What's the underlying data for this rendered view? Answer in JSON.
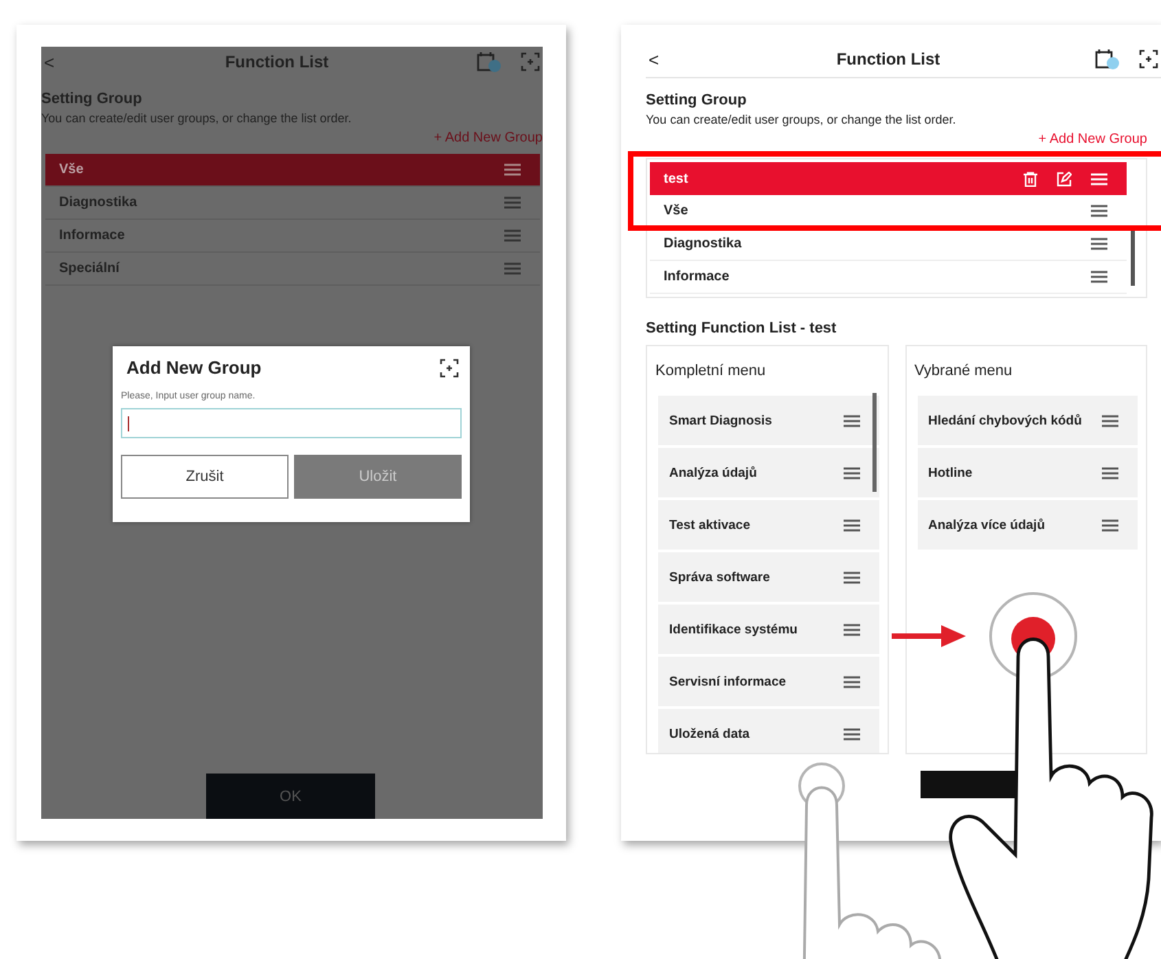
{
  "left_screen": {
    "header": {
      "back": "<",
      "title": "Function List"
    },
    "section_title": "Setting Group",
    "description": "You can create/edit user groups, or change the list order.",
    "add_link": "+ Add New Group",
    "groups": [
      {
        "label": "Vše",
        "selected": true
      },
      {
        "label": "Diagnostika",
        "selected": false
      },
      {
        "label": "Informace",
        "selected": false
      },
      {
        "label": "Speciální",
        "selected": false
      }
    ],
    "dialog": {
      "title": "Add New Group",
      "prompt": "Please, Input user group name.",
      "buttons": [
        {
          "label": "Zrušit",
          "kind": "secondary"
        },
        {
          "label": "Uložit",
          "kind": "primary"
        }
      ]
    },
    "ok_button": "OK"
  },
  "right_screen": {
    "header": {
      "back": "<",
      "title": "Function List"
    },
    "section_title": "Setting Group",
    "description": "You can create/edit user groups, or change the list order.",
    "add_link": "+ Add New Group",
    "groups": [
      {
        "label": "test",
        "selected": true
      },
      {
        "label": "Vše",
        "selected": false
      },
      {
        "label": "Diagnostika",
        "selected": false
      },
      {
        "label": "Informace",
        "selected": false
      }
    ],
    "function_list_title": "Setting Function List - test",
    "complete_menu": {
      "title": "Kompletní menu",
      "items": [
        "Smart Diagnosis",
        "Analýza údajů",
        "Test aktivace",
        "Správa software",
        "Identifikace systému",
        "Servisní informace",
        "Uložená data"
      ]
    },
    "selected_menu": {
      "title": "Vybrané menu",
      "items": [
        "Hledání chybových kódů",
        "Hotline",
        "Analýza více údajů"
      ]
    }
  }
}
